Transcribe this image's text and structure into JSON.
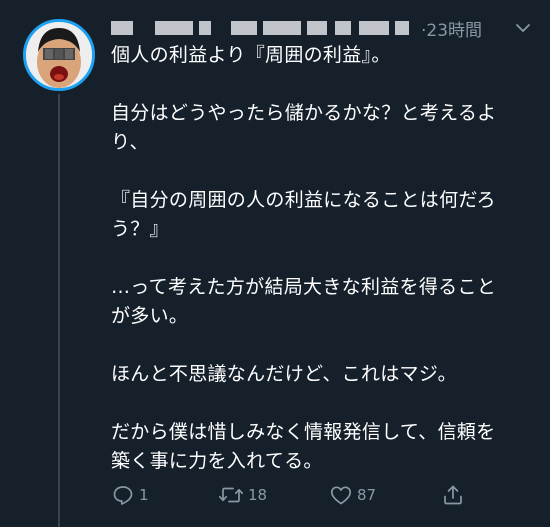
{
  "tweet": {
    "timestamp": "·23時間",
    "lines": [
      [
        "個人の利益より『周囲の利益』。"
      ],
      [
        "自分はどうやったら儲かるかな？と考えるよ",
        "り、"
      ],
      [
        "『自分の周囲の人の利益になることは何だろ",
        "う？』"
      ],
      [
        "…って考えた方が結局大きな利益を得ること",
        "が多い。"
      ],
      [
        "ほんと不思議なんだけど、これはマジ。"
      ],
      [
        "だから僕は惜しみなく情報発信して、信頼を",
        "築く事に力を入れてる。"
      ]
    ],
    "actions": {
      "reply_count": "1",
      "retweet_count": "18",
      "like_count": "87"
    }
  },
  "colors": {
    "background": "#15202b",
    "text": "#ffffff",
    "secondary": "#8899a6",
    "thread_line": "#38444d",
    "avatar_ring": "#1da1f2"
  },
  "icons": {
    "reply": "reply-icon",
    "retweet": "retweet-icon",
    "like": "heart-icon",
    "share": "share-icon",
    "menu": "chevron-down-icon"
  }
}
